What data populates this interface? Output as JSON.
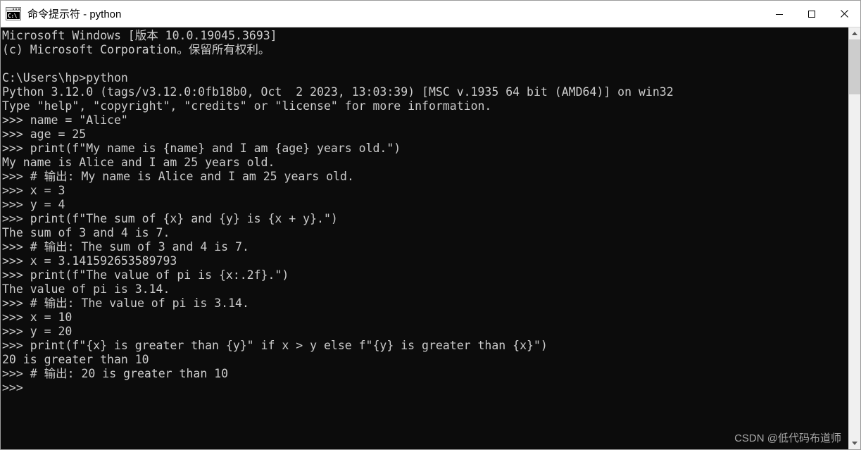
{
  "window": {
    "title": "命令提示符 - python",
    "icon_name": "cmd-console-icon",
    "icon_glyph": "C:\\",
    "background_color": "#0c0c0c",
    "text_color": "#cccccc",
    "titlebar_background": "#ffffff"
  },
  "window_controls": {
    "minimize_label": "最小化",
    "maximize_label": "最大化",
    "close_label": "关闭"
  },
  "scrollbar": {
    "up_arrow_label": "向上滚动",
    "down_arrow_label": "向下滚动",
    "thumb_label": "滚动条滑块"
  },
  "terminal": {
    "content": "Microsoft Windows [版本 10.0.19045.3693]\n(c) Microsoft Corporation。保留所有权利。\n\nC:\\Users\\hp>python\nPython 3.12.0 (tags/v3.12.0:0fb18b0, Oct  2 2023, 13:03:39) [MSC v.1935 64 bit (AMD64)] on win32\nType \"help\", \"copyright\", \"credits\" or \"license\" for more information.\n>>> name = \"Alice\"\n>>> age = 25\n>>> print(f\"My name is {name} and I am {age} years old.\")\nMy name is Alice and I am 25 years old.\n>>> # 输出: My name is Alice and I am 25 years old.\n>>> x = 3\n>>> y = 4\n>>> print(f\"The sum of {x} and {y} is {x + y}.\")\nThe sum of 3 and 4 is 7.\n>>> # 输出: The sum of 3 and 4 is 7.\n>>> x = 3.141592653589793\n>>> print(f\"The value of pi is {x:.2f}.\")\nThe value of pi is 3.14.\n>>> # 输出: The value of pi is 3.14.\n>>> x = 10\n>>> y = 20\n>>> print(f\"{x} is greater than {y}\" if x > y else f\"{y} is greater than {x}\")\n20 is greater than 10\n>>> # 输出: 20 is greater than 10\n>>> "
  },
  "watermark": {
    "text": "CSDN @低代码布道师"
  }
}
